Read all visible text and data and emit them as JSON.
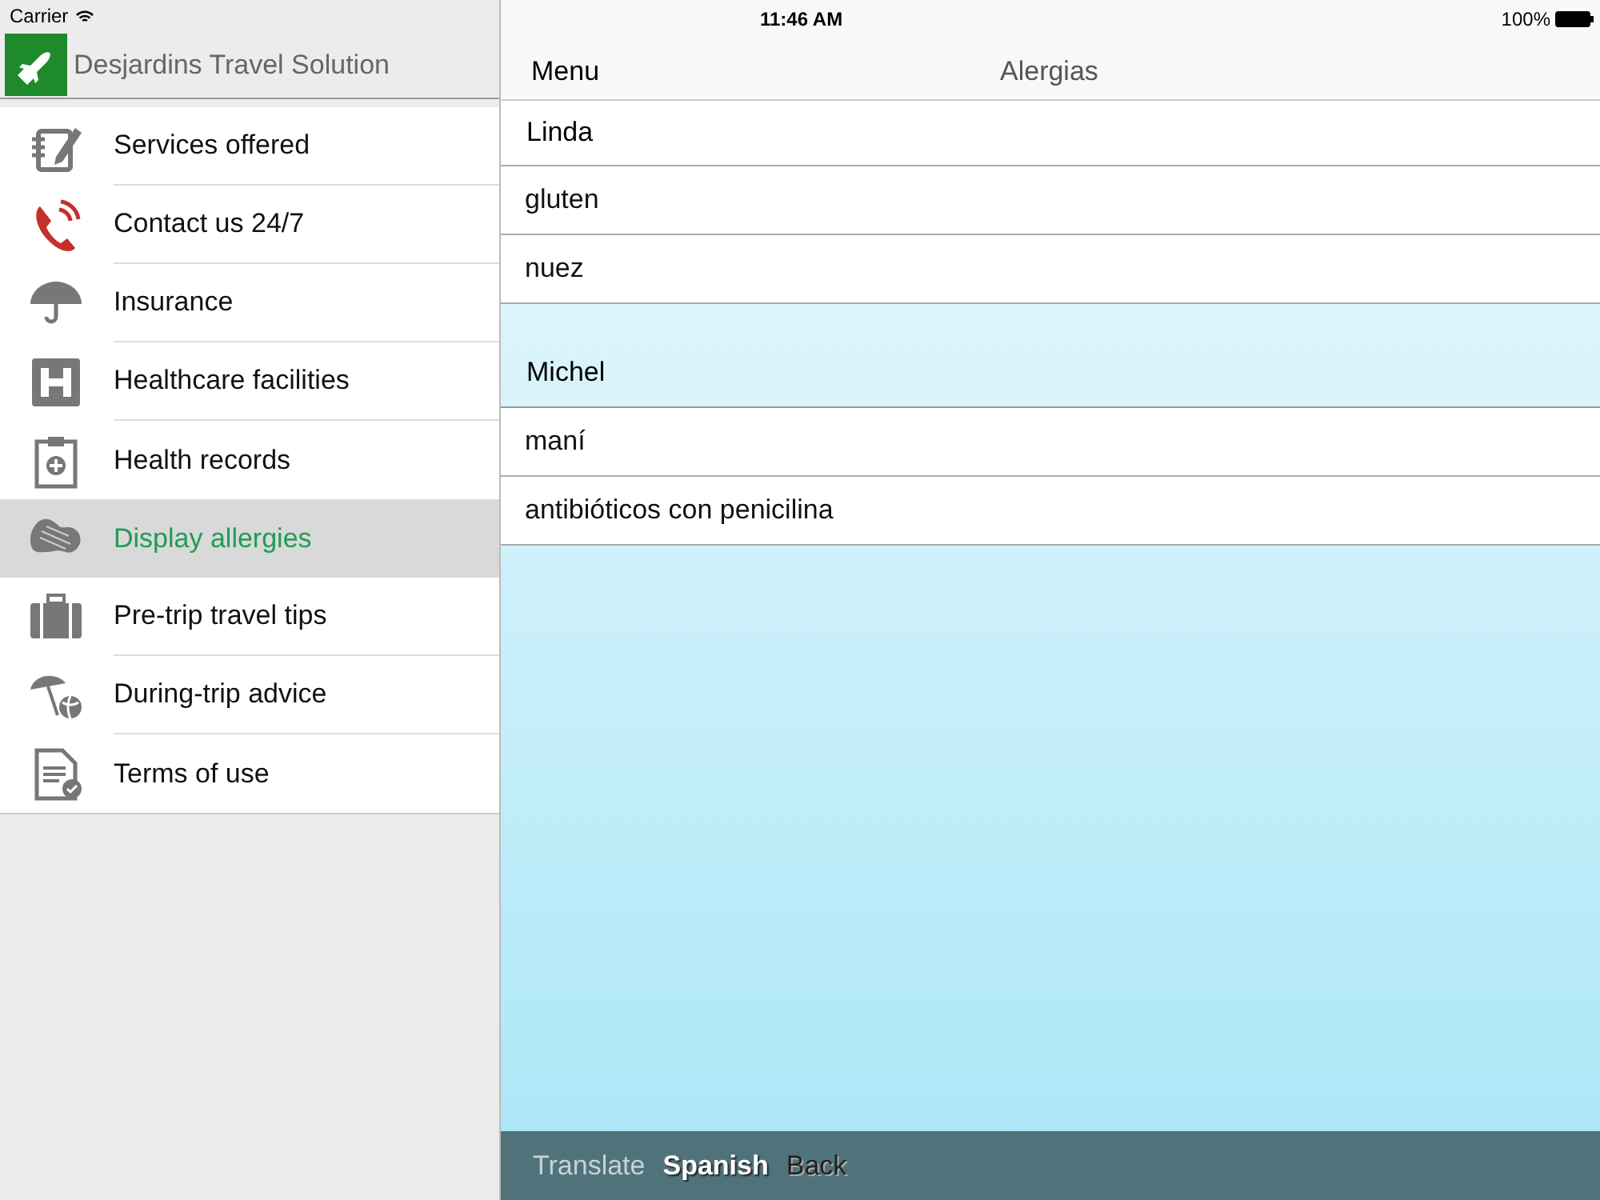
{
  "status_bar": {
    "carrier": "Carrier",
    "time": "11:46 AM",
    "battery": "100%"
  },
  "sidebar": {
    "app_title": "Desjardins Travel Solution",
    "items": [
      {
        "label": "Services offered",
        "selected": false
      },
      {
        "label": "Contact us 24/7",
        "selected": false
      },
      {
        "label": "Insurance",
        "selected": false
      },
      {
        "label": "Healthcare facilities",
        "selected": false
      },
      {
        "label": "Health records",
        "selected": false
      },
      {
        "label": "Display allergies",
        "selected": true
      },
      {
        "label": "Pre-trip travel tips",
        "selected": false
      },
      {
        "label": "During-trip advice",
        "selected": false
      },
      {
        "label": "Terms of use",
        "selected": false
      }
    ]
  },
  "nav_bar": {
    "back_label": "Menu",
    "title": "Alergias"
  },
  "groups": [
    {
      "name": "Linda",
      "items": [
        "gluten",
        "nuez"
      ]
    },
    {
      "name": "Michel",
      "items": [
        "maní",
        "antibióticos con penicilina"
      ]
    }
  ],
  "toolbar": {
    "label": "Translate",
    "language": "Spanish",
    "back": "Back"
  }
}
